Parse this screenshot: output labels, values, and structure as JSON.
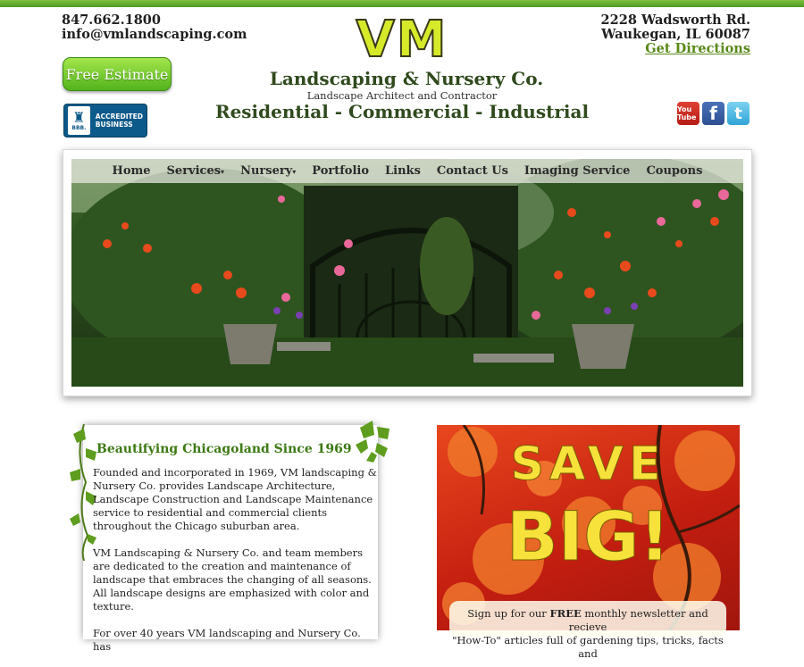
{
  "header": {
    "phone": "847.662.1800",
    "email": "info@vmlandscaping.com",
    "address_line1": "2228 Wadsworth Rd.",
    "address_line2": "Waukegan, IL 60087",
    "directions_link": "Get Directions",
    "estimate_button": "Free Estimate"
  },
  "bbb": {
    "seal_label": "BBB.",
    "line1": "ACCREDITED",
    "line2": "BUSINESS"
  },
  "logo": {
    "mark": "VM",
    "name": "Landscaping & Nursery Co.",
    "subtitle": "Landscape Architect and Contractor",
    "tagline": "Residential - Commercial - Industrial"
  },
  "social": [
    {
      "name": "youtube-icon",
      "label": "You Tube"
    },
    {
      "name": "facebook-icon",
      "label": "f"
    },
    {
      "name": "twitter-icon",
      "label": "t"
    }
  ],
  "nav": {
    "items": [
      "Home",
      "Services",
      "Nursery",
      "Portfolio",
      "Links",
      "Contact Us",
      "Imaging Service",
      "Coupons"
    ],
    "dropdown_marker": "▾"
  },
  "about": {
    "title": "Beautifying Chicagoland Since 1969",
    "paragraphs": [
      "Founded and incorporated in 1969, VM landscaping & Nursery Co. provides Landscape Architecture, Landscape Construction and Landscape Maintenance service to residential and commercial clients throughout the Chicago suburban area.",
      "VM Landscaping & Nursery Co. and team members are dedicated to the creation and maintenance of landscape that embraces the changing of all seasons. All landscape designs are emphasized with color and texture.",
      "For over 40 years VM landscaping and Nursery Co. has"
    ]
  },
  "promo": {
    "headline1": "SAVE",
    "headline2": "BIG!",
    "caption_pre": "Sign up for our ",
    "caption_bold": "FREE",
    "caption_post": " monthly newsletter and recieve",
    "caption_line2": "\"How-To\" articles full of gardening tips, tricks, facts and"
  },
  "colors": {
    "brand_green": "#3d7a14",
    "top_bar": "#5aa824",
    "logo_yellow": "#d6ea2a",
    "save_yellow": "#f6e23a"
  }
}
